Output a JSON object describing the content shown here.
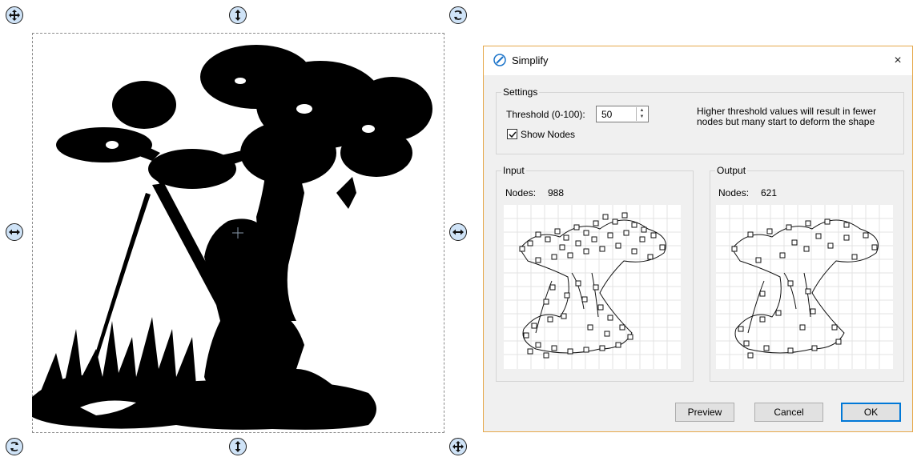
{
  "dialog": {
    "title": "Simplify",
    "close_glyph": "×",
    "settings": {
      "group_label": "Settings",
      "threshold_label": "Threshold (0-100):",
      "threshold_value": "50",
      "show_nodes_label": "Show Nodes",
      "show_nodes_checked": true,
      "hint_line1": "Higher threshold values will result in fewer",
      "hint_line2": "nodes but many start to deform the shape"
    },
    "input": {
      "group_label": "Input",
      "nodes_label": "Nodes:",
      "nodes_value": "988"
    },
    "output": {
      "group_label": "Output",
      "nodes_label": "Nodes:",
      "nodes_value": "621"
    },
    "buttons": {
      "preview": "Preview",
      "cancel": "Cancel",
      "ok": "OK"
    }
  },
  "canvas": {
    "handles": [
      "move-icon",
      "vertical-resize-icon",
      "rotate-icon",
      "horizontal-resize-icon",
      "rotate-icon",
      "vertical-resize-icon"
    ]
  },
  "colors": {
    "accent": "#0078d7",
    "handle_fill": "#cfe3f7",
    "dialog_border": "#e6a84a"
  }
}
